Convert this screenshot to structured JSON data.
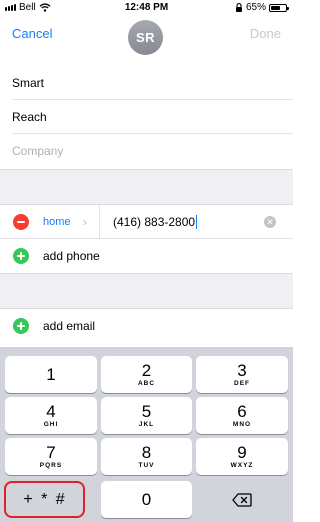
{
  "status_bar": {
    "carrier": "Bell",
    "time": "12:48 PM",
    "battery": "65%",
    "battery_level": 0.65
  },
  "nav": {
    "cancel_label": "Cancel",
    "avatar_initials": "SR",
    "done_label": "Done"
  },
  "fields": {
    "first_name": "Smart",
    "last_name": "Reach",
    "company_placeholder": "Company"
  },
  "phone": {
    "label": "home",
    "value": "(416) 883-2800",
    "add_label": "add phone"
  },
  "email": {
    "add_label": "add email"
  },
  "icons": {
    "remove": "minus-circle-icon",
    "add": "plus-circle-icon",
    "clear": "clear-icon",
    "chevron": "chevron-right-icon",
    "delete": "backspace-icon",
    "wifi": "wifi-icon",
    "lock": "lock-icon"
  },
  "colors": {
    "accent": "#1a7ef5",
    "remove": "#fa3b30",
    "add": "#34c759",
    "highlight": "#e0202a"
  },
  "keypad": {
    "keys": [
      {
        "num": "1",
        "letters": ""
      },
      {
        "num": "2",
        "letters": "ABC"
      },
      {
        "num": "3",
        "letters": "DEF"
      },
      {
        "num": "4",
        "letters": "GHI"
      },
      {
        "num": "5",
        "letters": "JKL"
      },
      {
        "num": "6",
        "letters": "MNO"
      },
      {
        "num": "7",
        "letters": "PQRS"
      },
      {
        "num": "8",
        "letters": "TUV"
      },
      {
        "num": "9",
        "letters": "WXYZ"
      }
    ],
    "symbols_label": "+ * #",
    "zero": "0"
  }
}
